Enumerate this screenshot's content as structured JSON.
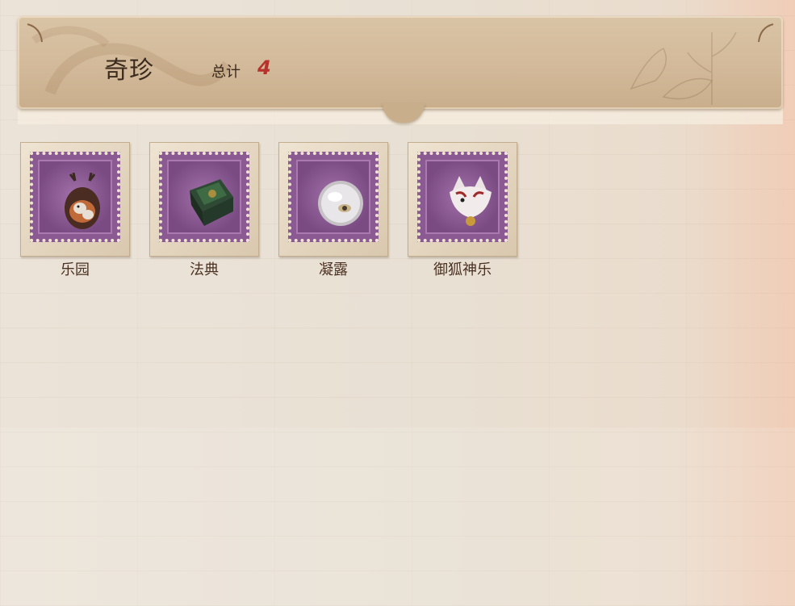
{
  "header": {
    "title": "奇珍",
    "total_label": "总计",
    "total_count": "4"
  },
  "items": [
    {
      "name": "乐园",
      "icon": "antlered-rabbit-icon"
    },
    {
      "name": "法典",
      "icon": "green-codex-book-icon"
    },
    {
      "name": "凝露",
      "icon": "pearl-orb-icon"
    },
    {
      "name": "御狐神乐",
      "icon": "fox-mask-icon"
    }
  ],
  "colors": {
    "stamp_purple": "#8b5a93",
    "count_red": "#b7322c",
    "header_tan": "#d2b999",
    "text_brown": "#3b2a1e"
  }
}
